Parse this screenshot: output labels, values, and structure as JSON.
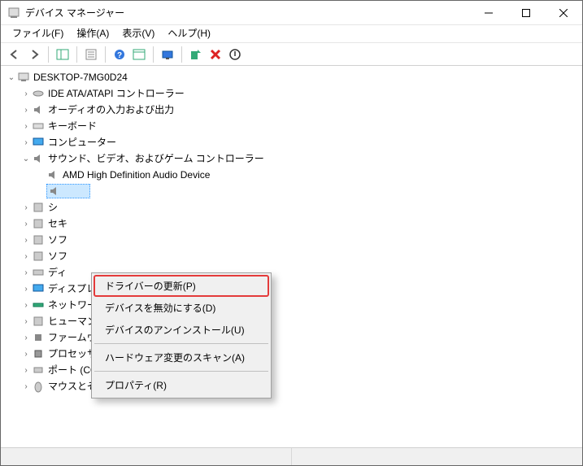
{
  "titlebar": {
    "title": "デバイス マネージャー"
  },
  "menubar": {
    "file": "ファイル(F)",
    "action": "操作(A)",
    "view": "表示(V)",
    "help": "ヘルプ(H)"
  },
  "tree": {
    "root": "DESKTOP-7MG0D24",
    "nodes": [
      {
        "label": "IDE ATA/ATAPI コントローラー",
        "expanded": false
      },
      {
        "label": "オーディオの入力および出力",
        "expanded": false
      },
      {
        "label": "キーボード",
        "expanded": false
      },
      {
        "label": "コンピューター",
        "expanded": false
      },
      {
        "label": "サウンド、ビデオ、およびゲーム コントローラー",
        "expanded": true,
        "children": [
          {
            "label": "AMD High Definition Audio Device"
          },
          {
            "label": "",
            "selected": true
          }
        ]
      },
      {
        "label": "シ",
        "truncated": true
      },
      {
        "label": "セキ",
        "truncated": true
      },
      {
        "label": "ソフ",
        "truncated": true
      },
      {
        "label": "ソフ",
        "truncated": true
      },
      {
        "label": "ディ",
        "truncated": true
      },
      {
        "label": "ディスプレイ アダプター",
        "expanded": false
      },
      {
        "label": "ネットワーク アダプター",
        "expanded": false
      },
      {
        "label": "ヒューマン インターフェイス デバイス",
        "expanded": false
      },
      {
        "label": "ファームウェア",
        "expanded": false
      },
      {
        "label": "プロセッサ",
        "expanded": false
      },
      {
        "label": "ポート (COM と LPT)",
        "expanded": false
      },
      {
        "label": "マウスとそのほかのポインティング デバイス",
        "expanded": false
      }
    ]
  },
  "context_menu": {
    "items": [
      {
        "label": "ドライバーの更新(P)",
        "highlighted": true
      },
      {
        "label": "デバイスを無効にする(D)"
      },
      {
        "label": "デバイスのアンインストール(U)"
      },
      {
        "sep": true
      },
      {
        "label": "ハードウェア変更のスキャン(A)"
      },
      {
        "sep": true
      },
      {
        "label": "プロパティ(R)"
      }
    ]
  }
}
